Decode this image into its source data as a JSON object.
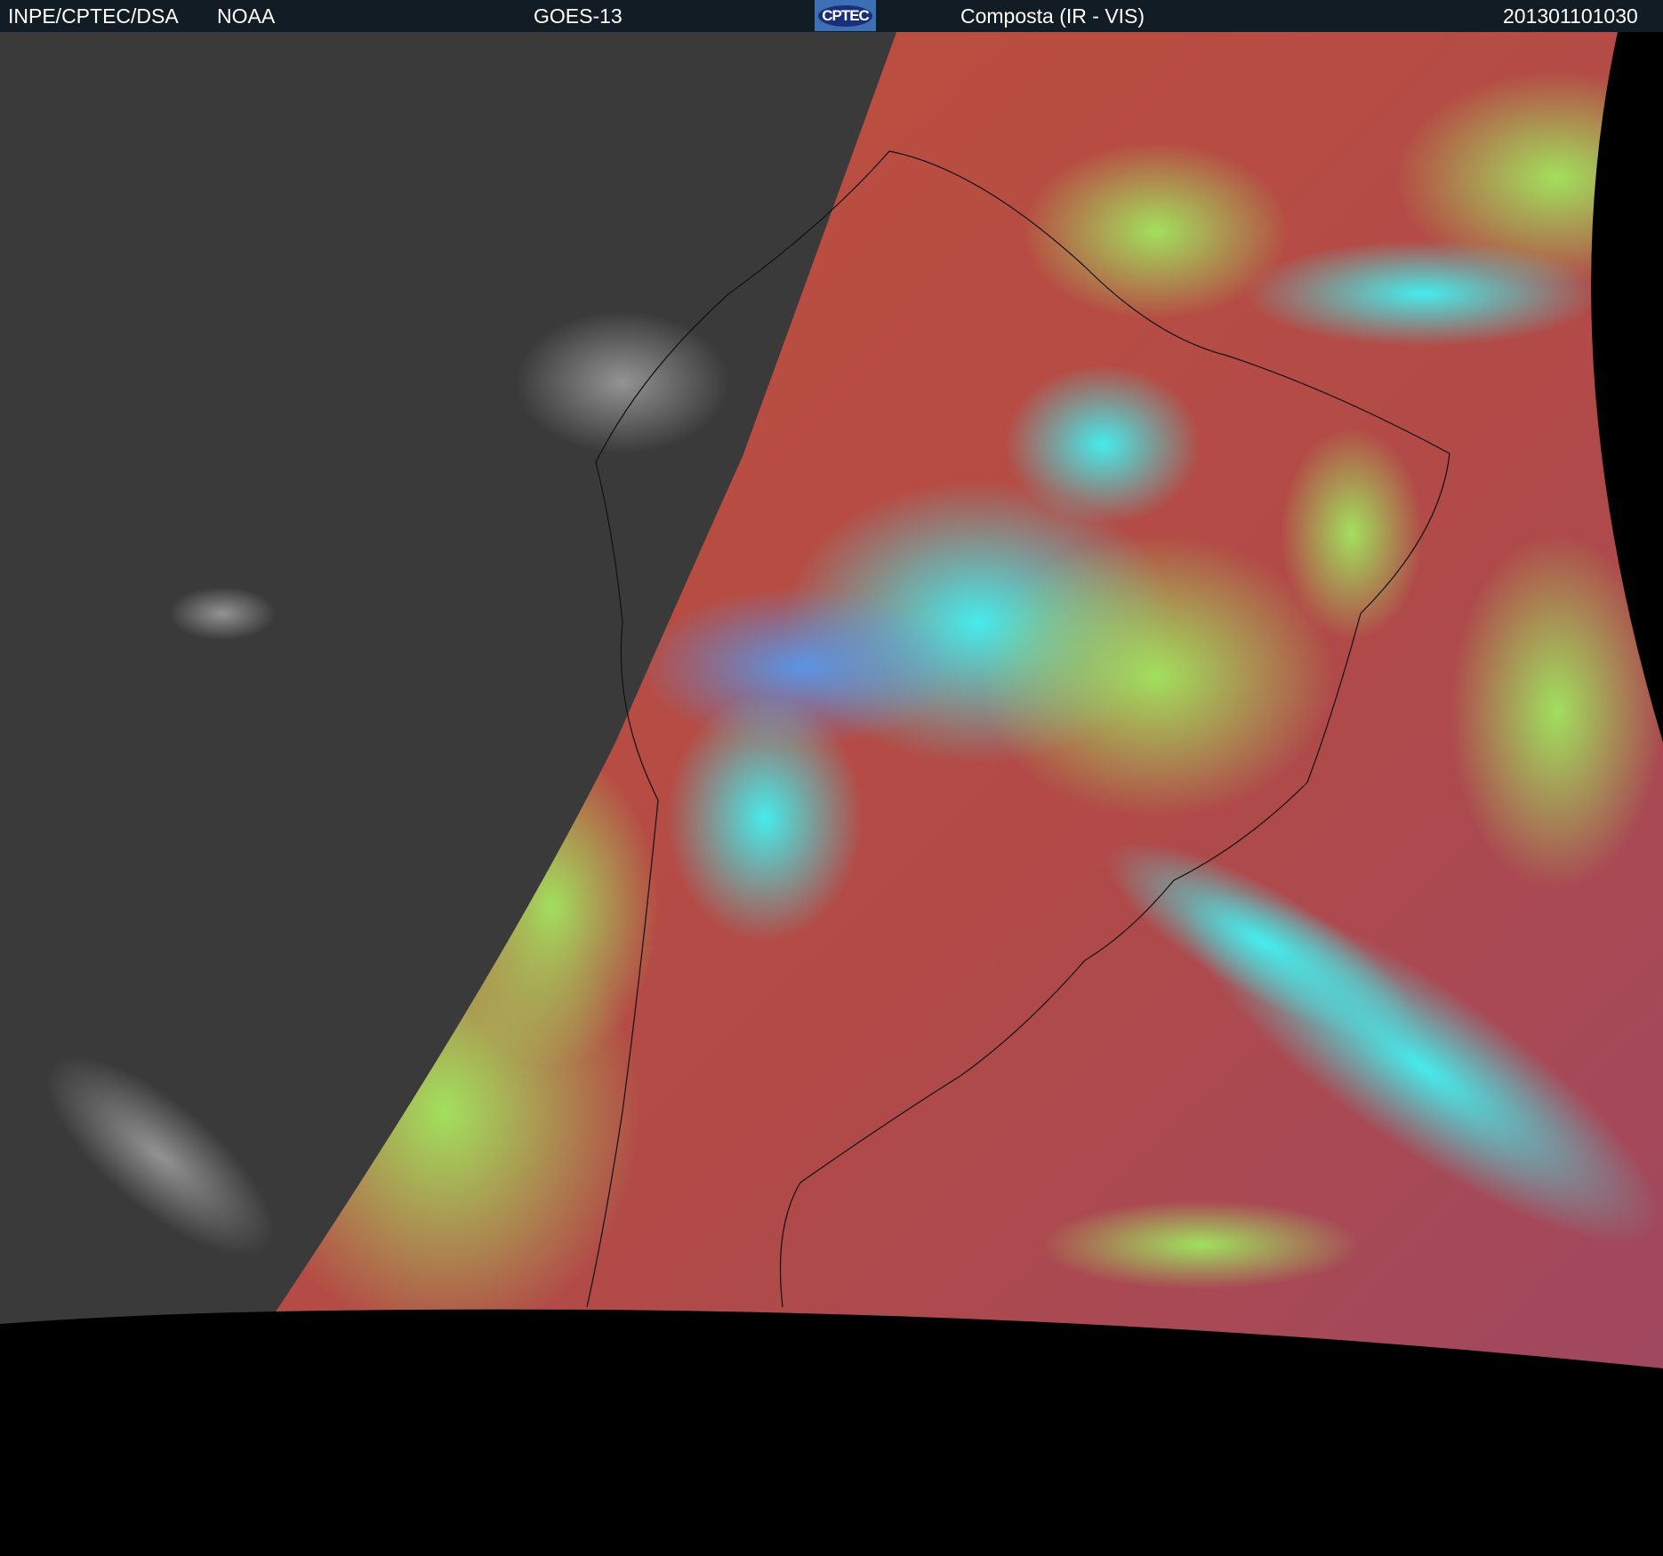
{
  "header": {
    "source": "INPE/CPTEC/DSA",
    "agency": "NOAA",
    "satellite": "GOES-13",
    "logo_text": "CPTEC",
    "product": "Composta (IR - VIS)",
    "timestamp": "201301101030"
  },
  "colors": {
    "header_bg": "#121c25",
    "night_gray": "#3a3a3a",
    "land_red": "#b44a44",
    "cloud_cyan": "#3ff0f0",
    "cloud_green": "#9af060"
  }
}
